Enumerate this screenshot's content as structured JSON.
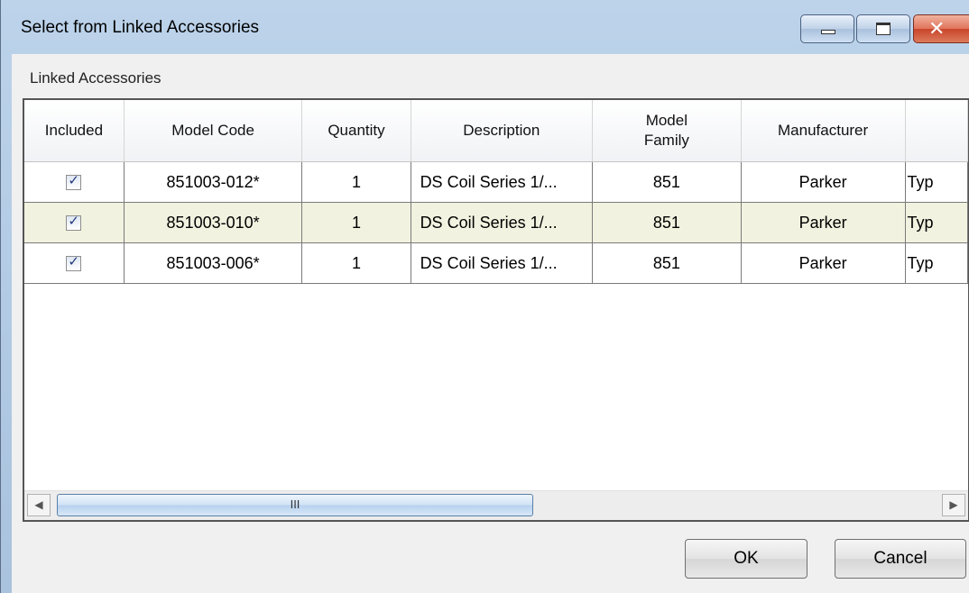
{
  "window": {
    "title": "Select from Linked Accessories"
  },
  "group": {
    "label": "Linked Accessories"
  },
  "grid": {
    "columns": [
      "Included",
      "Model Code",
      "Quantity",
      "Description",
      "Model Family",
      "Manufacturer",
      ""
    ],
    "rows": [
      {
        "included": true,
        "model_code": "851003-012*",
        "quantity": "1",
        "description": "DS Coil Series 1/...",
        "model_family": "851",
        "manufacturer": "Parker",
        "extra": "Typ"
      },
      {
        "included": true,
        "model_code": "851003-010*",
        "quantity": "1",
        "description": "DS Coil Series 1/...",
        "model_family": "851",
        "manufacturer": "Parker",
        "extra": "Typ"
      },
      {
        "included": true,
        "model_code": "851003-006*",
        "quantity": "1",
        "description": "DS Coil Series 1/...",
        "model_family": "851",
        "manufacturer": "Parker",
        "extra": "Typ"
      }
    ],
    "scrollbar": {
      "thumb_grip": "III"
    }
  },
  "buttons": {
    "ok": "OK",
    "cancel": "Cancel"
  }
}
